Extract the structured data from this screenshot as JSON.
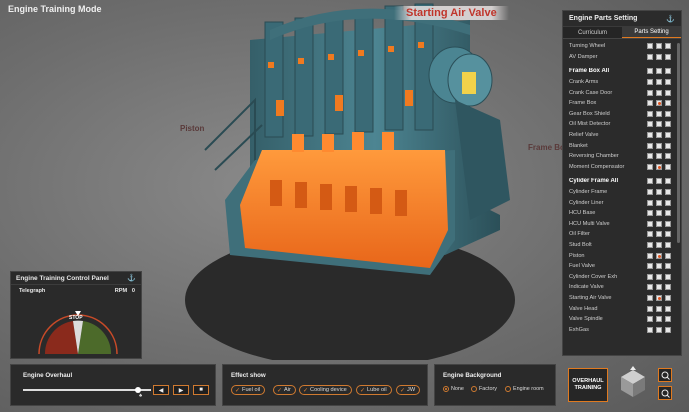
{
  "app": {
    "title": "Engine Training Mode"
  },
  "scene": {
    "callouts": {
      "starting_air_valve": "Starting Air Valve",
      "piston": "Piston",
      "frame_box": "Frame Box"
    }
  },
  "parts_panel": {
    "title": "Engine Parts Setting",
    "tabs": [
      "Curriculum",
      "Parts Setting"
    ],
    "active_tab": "Parts Setting",
    "rows": [
      {
        "label": "Turning Wheel",
        "group": false,
        "checks": [
          false,
          false,
          false
        ]
      },
      {
        "label": "AV Damper",
        "group": false,
        "checks": [
          false,
          false,
          false
        ]
      },
      {
        "label": "Frame Box All",
        "group": true,
        "checks": [
          false,
          false,
          false
        ]
      },
      {
        "label": "Crank Arms",
        "group": false,
        "checks": [
          false,
          false,
          false
        ]
      },
      {
        "label": "Crank Case Door",
        "group": false,
        "checks": [
          false,
          false,
          false
        ]
      },
      {
        "label": "Frame Box",
        "group": false,
        "checks": [
          false,
          true,
          false
        ]
      },
      {
        "label": "Gear Box Shield",
        "group": false,
        "checks": [
          false,
          false,
          false
        ]
      },
      {
        "label": "Oil Mist Detector",
        "group": false,
        "checks": [
          false,
          false,
          false
        ]
      },
      {
        "label": "Relief Valve",
        "group": false,
        "checks": [
          false,
          false,
          false
        ]
      },
      {
        "label": "Blanket",
        "group": false,
        "checks": [
          false,
          false,
          false
        ]
      },
      {
        "label": "Reversing Chamber",
        "group": false,
        "checks": [
          false,
          false,
          false
        ]
      },
      {
        "label": "Moment Compensator",
        "group": false,
        "checks": [
          false,
          true,
          false
        ]
      },
      {
        "label": "Cylider Frame All",
        "group": true,
        "checks": [
          false,
          false,
          false
        ]
      },
      {
        "label": "Cylinder Frame",
        "group": false,
        "checks": [
          false,
          false,
          false
        ]
      },
      {
        "label": "Cylinder Liner",
        "group": false,
        "checks": [
          false,
          false,
          false
        ]
      },
      {
        "label": "HCU Base",
        "group": false,
        "checks": [
          false,
          false,
          false
        ]
      },
      {
        "label": "HCU Multi Valve",
        "group": false,
        "checks": [
          false,
          false,
          false
        ]
      },
      {
        "label": "Oil Filter",
        "group": false,
        "checks": [
          false,
          false,
          false
        ]
      },
      {
        "label": "Stud Bolt",
        "group": false,
        "checks": [
          false,
          false,
          false
        ]
      },
      {
        "label": "Piston",
        "group": false,
        "checks": [
          false,
          true,
          false
        ]
      },
      {
        "label": "Fuel Valve",
        "group": false,
        "checks": [
          false,
          false,
          false
        ]
      },
      {
        "label": "Cylinder Cover Exh",
        "group": false,
        "checks": [
          false,
          false,
          false
        ]
      },
      {
        "label": "Indicate Valve",
        "group": false,
        "checks": [
          false,
          false,
          false
        ]
      },
      {
        "label": "Starting Air Valve",
        "group": false,
        "checks": [
          false,
          true,
          false
        ]
      },
      {
        "label": "Valve Head",
        "group": false,
        "checks": [
          false,
          false,
          false
        ]
      },
      {
        "label": "Valve Spindle",
        "group": false,
        "checks": [
          false,
          false,
          false
        ]
      },
      {
        "label": "ExhGas",
        "group": false,
        "checks": [
          false,
          false,
          false
        ]
      }
    ]
  },
  "control_panel": {
    "title": "Engine Training Control Panel",
    "telegraph_label": "Telegraph",
    "rpm_label": "RPM",
    "rpm_value": "0",
    "gauge_center": "STOP"
  },
  "overhaul": {
    "label": "Engine Overhaul",
    "progress": 0.9
  },
  "effect_show": {
    "label": "Effect show",
    "items": [
      "Fuel oil",
      "Air",
      "Cooling device",
      "Lube oil",
      "JW"
    ]
  },
  "background": {
    "label": "Engine Background",
    "options": [
      "None",
      "Factory",
      "Engine room"
    ],
    "selected": "None"
  },
  "overhaul_training_button": "OVERHAUL TRAINING",
  "colors": {
    "accent": "#e07a20",
    "panel": "#2a2a2a",
    "engine_blue": "#3f6f7a",
    "highlight_orange": "#f07a20"
  }
}
